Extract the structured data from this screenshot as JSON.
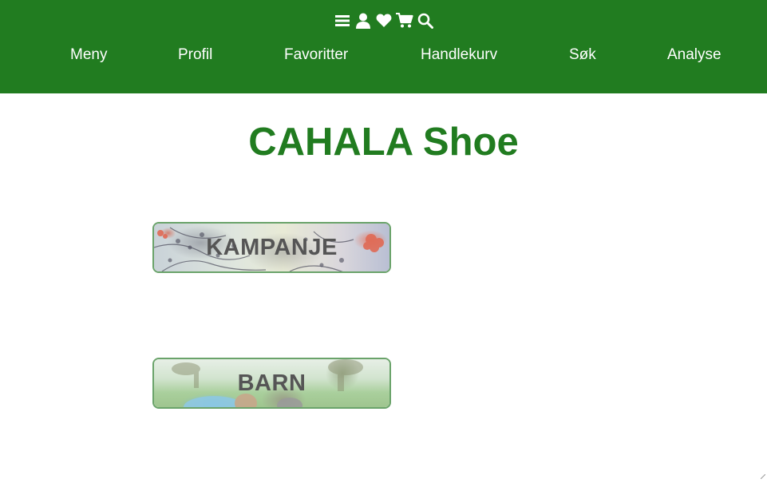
{
  "header": {
    "background_color": "#217c20",
    "icons": [
      "menu-icon",
      "user-icon",
      "heart-icon",
      "cart-icon",
      "search-icon"
    ],
    "nav": [
      {
        "label": "Meny"
      },
      {
        "label": "Profil"
      },
      {
        "label": "Favoritter"
      },
      {
        "label": "Handlekurv"
      },
      {
        "label": "Søk"
      },
      {
        "label": "Analyse"
      }
    ]
  },
  "main": {
    "title": "CAHALA Shoe",
    "title_color": "#217c20",
    "categories": [
      {
        "label": "KAMPANJE"
      },
      {
        "label": "BARN"
      }
    ]
  }
}
